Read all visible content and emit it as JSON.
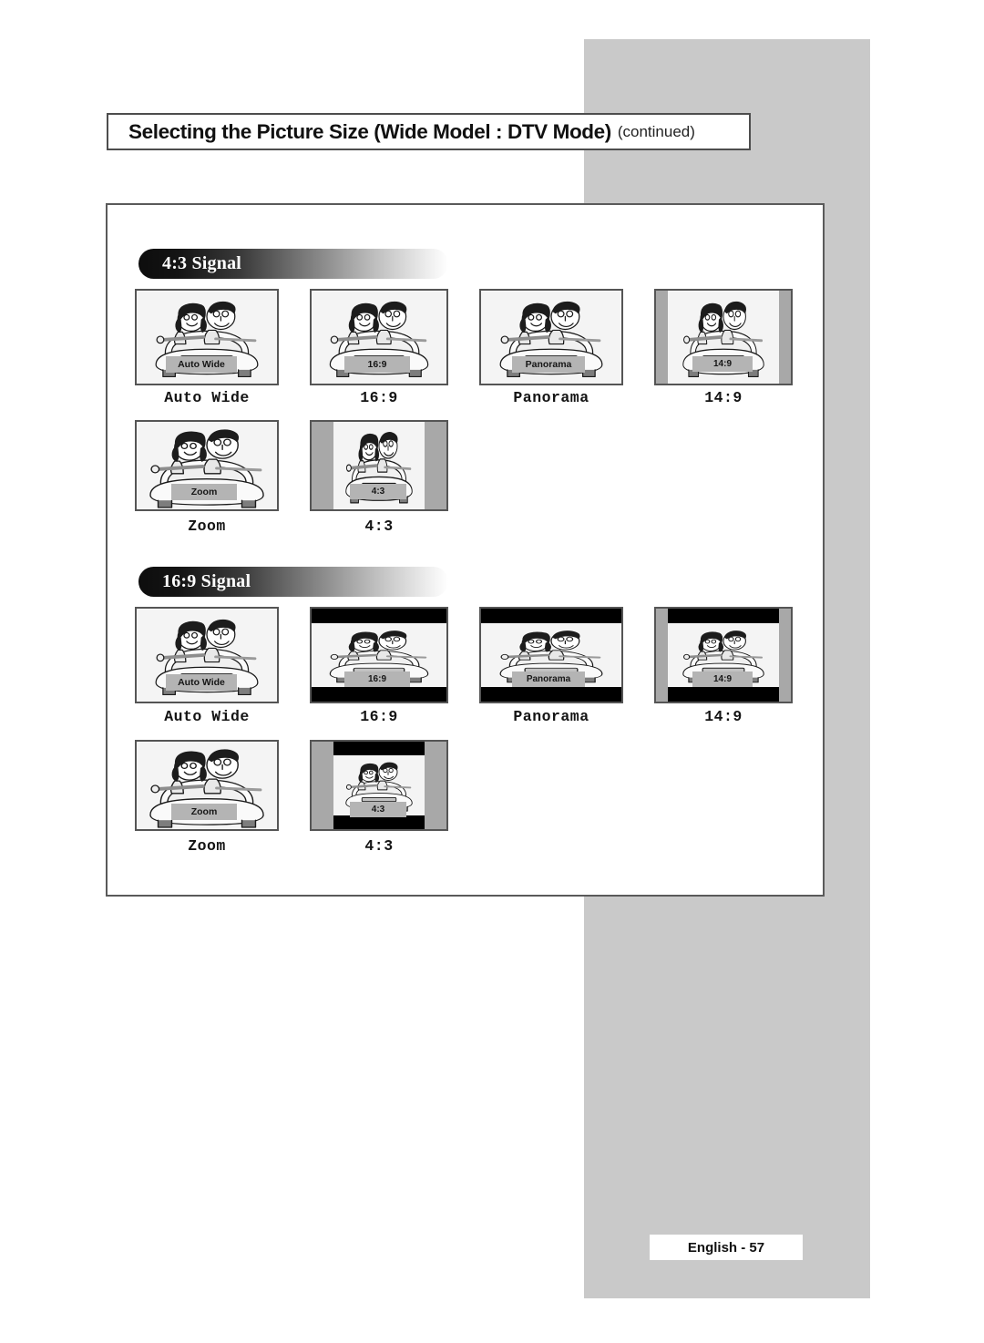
{
  "page": {
    "title_main": "Selecting the Picture Size (Wide Model : DTV Mode)",
    "title_continued": "(continued)",
    "footer_label": "English - 57",
    "background_color": "#ffffff",
    "band_color": "#c9c9c9",
    "accent_border_color": "#555555"
  },
  "sections": [
    {
      "id": "signal-4-3",
      "heading": "4:3 Signal",
      "items": [
        {
          "caption": "Auto Wide",
          "badge": "Auto Wide",
          "bars": {
            "side": "none",
            "letterbox": "none"
          }
        },
        {
          "caption": "16:9",
          "badge": "16:9",
          "bars": {
            "side": "none",
            "letterbox": "none"
          }
        },
        {
          "caption": "Panorama",
          "badge": "Panorama",
          "bars": {
            "side": "none",
            "letterbox": "none"
          }
        },
        {
          "caption": "14:9",
          "badge": "14:9",
          "bars": {
            "side": "narrow",
            "letterbox": "none"
          }
        },
        {
          "caption": "Zoom",
          "badge": "Zoom",
          "bars": {
            "side": "none",
            "letterbox": "none"
          }
        },
        {
          "caption": "4:3",
          "badge": "4:3",
          "bars": {
            "side": "wide",
            "letterbox": "none"
          }
        }
      ]
    },
    {
      "id": "signal-16-9",
      "heading": "16:9 Signal",
      "items": [
        {
          "caption": "Auto Wide",
          "badge": "Auto Wide",
          "bars": {
            "side": "none",
            "letterbox": "none"
          }
        },
        {
          "caption": "16:9",
          "badge": "16:9",
          "bars": {
            "side": "none",
            "letterbox": "yes"
          }
        },
        {
          "caption": "Panorama",
          "badge": "Panorama",
          "bars": {
            "side": "none",
            "letterbox": "yes"
          }
        },
        {
          "caption": "14:9",
          "badge": "14:9",
          "bars": {
            "side": "narrow",
            "letterbox": "yes"
          }
        },
        {
          "caption": "Zoom",
          "badge": "Zoom",
          "bars": {
            "side": "none",
            "letterbox": "none"
          }
        },
        {
          "caption": "4:3",
          "badge": "4:3",
          "bars": {
            "side": "wide",
            "letterbox": "yes"
          }
        }
      ]
    }
  ],
  "illustration": {
    "name": "two-people-in-car",
    "description": "Cartoon of a girl and a boy riding in a convertible car, front view"
  }
}
